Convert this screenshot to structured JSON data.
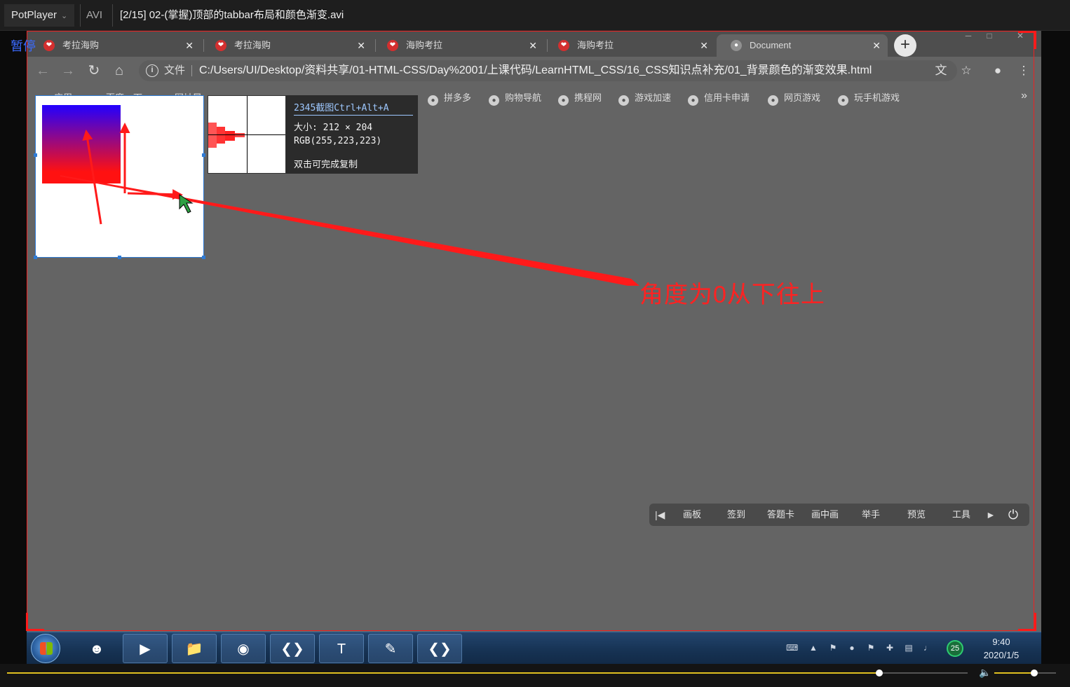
{
  "player": {
    "app_name": "PotPlayer",
    "format": "AVI",
    "file_title": "[2/15] 02-(掌握)顶部的tabbar布局和颜色渐变.avi",
    "status": "暂停",
    "seek_progress": 0.908,
    "volume_level": 0.65
  },
  "browser": {
    "tabs": [
      {
        "label": "考拉海购",
        "active": false
      },
      {
        "label": "考拉海购",
        "active": false
      },
      {
        "label": "海购考拉",
        "active": false
      },
      {
        "label": "海购考拉",
        "active": false
      },
      {
        "label": "Document",
        "active": true
      }
    ],
    "address": {
      "scheme_label": "文件",
      "url": "C:/Users/UI/Desktop/资料共享/01-HTML-CSS/Day%2001/上课代码/LearnHTML_CSS/16_CSS知识点补充/01_背景颜色的渐变效果.html"
    },
    "bookmarks": [
      "应用",
      "百度一下",
      "网址导航",
      "拼多多",
      "购物导航",
      "携程网",
      "游戏加速",
      "信用卡申请",
      "网页游戏",
      "玩手机游戏"
    ],
    "bookmarks_partial_label": "网址导"
  },
  "screenshot_tool": {
    "title": "2345截图Ctrl+Alt+A",
    "size_label": "大小: 212 × 204",
    "color_label": "RGB(255,223,223)",
    "hint": "双击可完成复制"
  },
  "annotation_text": "角度为0从下往上",
  "class_toolbar": {
    "items": [
      "画板",
      "签到",
      "答题卡",
      "画中画",
      "举手",
      "预览",
      "工具"
    ]
  },
  "taskbar": {
    "clock_time": "9:40",
    "clock_date": "2020/1/5",
    "badge_count": "25"
  },
  "colors": {
    "annotation_red": "#ff2222",
    "gradient_top": "#2200ff",
    "gradient_bottom": "#ff1111",
    "seek_accent": "#e0c020"
  }
}
